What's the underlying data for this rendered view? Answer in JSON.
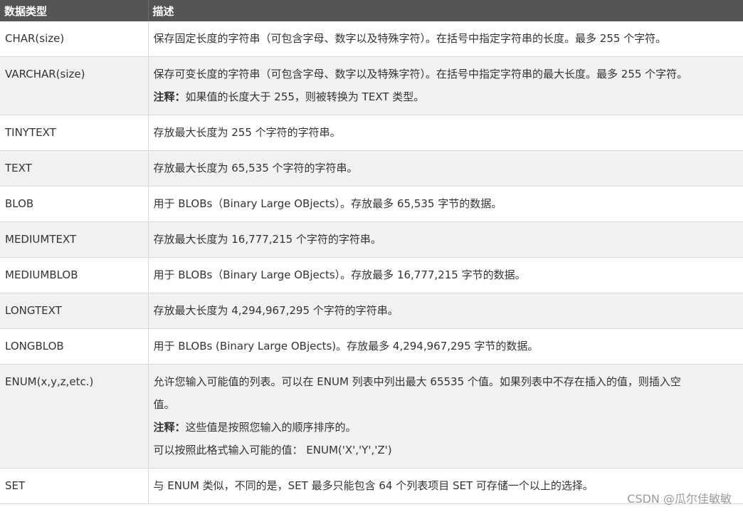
{
  "header": {
    "col_type": "数据类型",
    "col_desc": "描述"
  },
  "rows": [
    {
      "type": "CHAR(size)",
      "desc": "保存固定长度的字符串（可包含字母、数字以及特殊字符）。在括号中指定字符串的长度。最多 255 个字符。"
    },
    {
      "type": "VARCHAR(size)",
      "desc": "保存可变长度的字符串（可包含字母、数字以及特殊字符）。在括号中指定字符串的最大长度。最多 255 个字符。",
      "note_label": "注释：",
      "note": "如果值的长度大于 255，则被转换为 TEXT 类型。"
    },
    {
      "type": "TINYTEXT",
      "desc": "存放最大长度为 255 个字符的字符串。"
    },
    {
      "type": "TEXT",
      "desc": "存放最大长度为 65,535 个字符的字符串。"
    },
    {
      "type": "BLOB",
      "desc": "用于 BLOBs（Binary Large OBjects）。存放最多 65,535 字节的数据。"
    },
    {
      "type": "MEDIUMTEXT",
      "desc": "存放最大长度为 16,777,215 个字符的字符串。"
    },
    {
      "type": "MEDIUMBLOB",
      "desc": "用于 BLOBs（Binary Large OBjects）。存放最多 16,777,215 字节的数据。"
    },
    {
      "type": "LONGTEXT",
      "desc": "存放最大长度为 4,294,967,295 个字符的字符串。"
    },
    {
      "type": "LONGBLOB",
      "desc": "用于 BLOBs (Binary Large OBjects)。存放最多 4,294,967,295 字节的数据。"
    },
    {
      "type": "ENUM(x,y,z,etc.)",
      "desc_line1": "允许您输入可能值的列表。可以在 ENUM 列表中列出最大 65535 个值。如果列表中不存在插入的值，则插入空",
      "desc_line2": "值。",
      "note_label": "注释：",
      "note": "这些值是按照您输入的顺序排序的。",
      "extra": "可以按照此格式输入可能的值： ENUM('X','Y','Z')"
    },
    {
      "type": "SET",
      "desc": "与 ENUM 类似，不同的是，SET 最多只能包含 64 个列表项目 SET 可存储一个以上的选择。"
    }
  ],
  "watermark": "CSDN @瓜尔佳敏敏"
}
